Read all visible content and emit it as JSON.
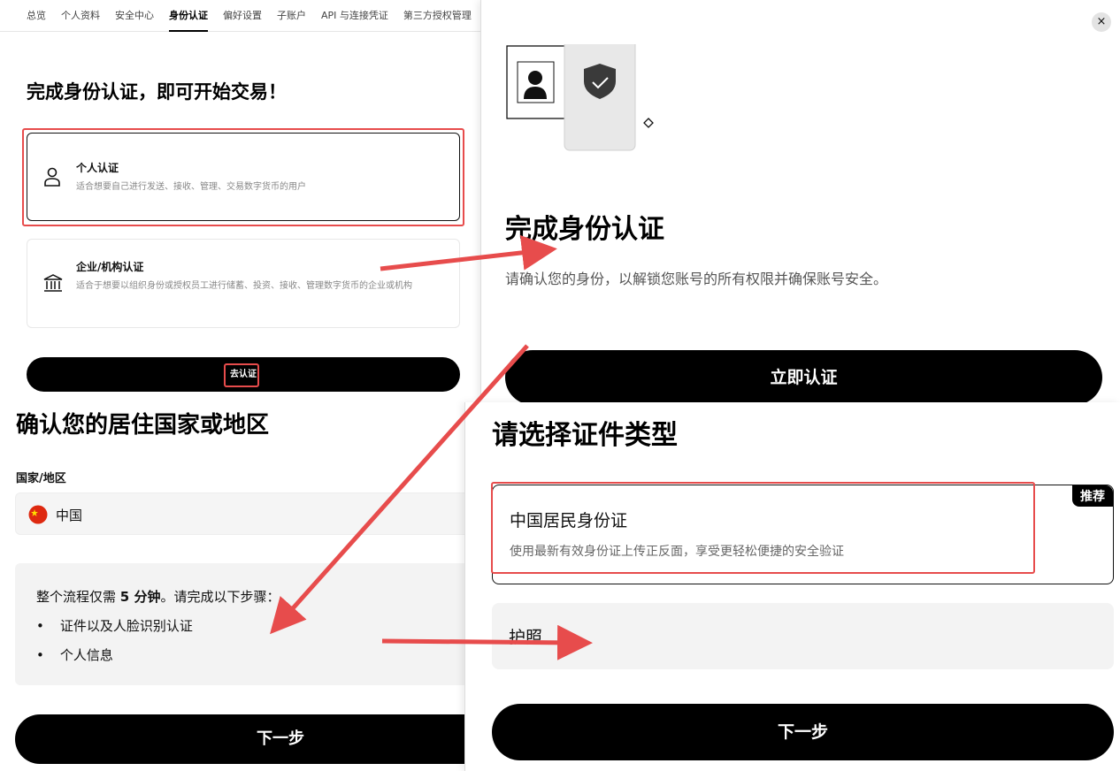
{
  "panel1": {
    "nav": [
      "总览",
      "个人资料",
      "安全中心",
      "身份认证",
      "偏好设置",
      "子账户",
      "API 与连接凭证",
      "第三方授权管理"
    ],
    "active_nav": "身份认证",
    "title": "完成身份认证，即可开始交易！",
    "options": [
      {
        "icon": "person-icon",
        "title": "个人认证",
        "desc": "适合想要自己进行发送、接收、管理、交易数字货币的用户"
      },
      {
        "icon": "bank-icon",
        "title": "企业/机构认证",
        "desc": "适合于想要以组织身份或授权员工进行储蓄、投资、接收、管理数字货币的企业或机构"
      }
    ],
    "cta": "去认证"
  },
  "panel2": {
    "close": "×",
    "title": "完成身份认证",
    "subtitle": "请确认您的身份，以解锁您账号的所有权限并确保账号安全。",
    "cta": "立即认证"
  },
  "panel3": {
    "title": "确认您的居住国家或地区",
    "label": "国家/地区",
    "country": "中国",
    "info_intro_a": "整个流程仅需 ",
    "info_intro_b": "5 分钟",
    "info_intro_c": "。请完成以下步骤：",
    "steps": [
      "证件以及人脸识别认证",
      "个人信息"
    ],
    "cta": "下一步"
  },
  "panel4": {
    "title": "请选择证件类型",
    "options": [
      {
        "title": "中国居民身份证",
        "desc": "使用最新有效身份证上传正反面，享受更轻松便捷的安全验证",
        "badge": "推荐"
      },
      {
        "title": "护照"
      }
    ],
    "cta": "下一步"
  },
  "colors": {
    "annotation": "#e74c4c",
    "primary": "#000000"
  }
}
